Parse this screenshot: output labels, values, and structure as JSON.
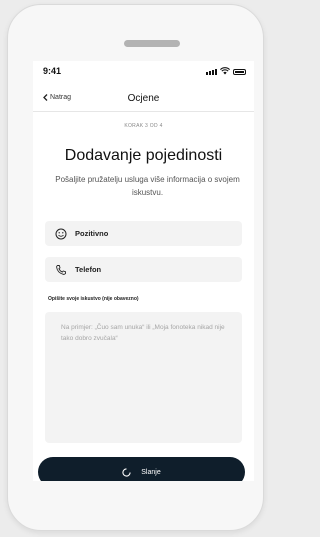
{
  "status": {
    "time": "9:41"
  },
  "nav": {
    "back_label": "Natrag",
    "title": "Ocjene"
  },
  "step_label": "KORAK 3 OD 4",
  "heading": "Dodavanje pojedinosti",
  "subtitle": "Pošaljite pružatelju usluga više informacija o svojem iskustvu.",
  "options": [
    {
      "label": "Pozitivno",
      "icon": "smiley-icon"
    },
    {
      "label": "Telefon",
      "icon": "phone-icon"
    }
  ],
  "description": {
    "label": "Opišite svoje iskustvo (nije obavezno)",
    "placeholder": "Na primjer: „Čuo sam unuka“ ili „Moja fonoteka nikad nije tako dobro zvučala“"
  },
  "send_button": {
    "label": "Slanje"
  }
}
